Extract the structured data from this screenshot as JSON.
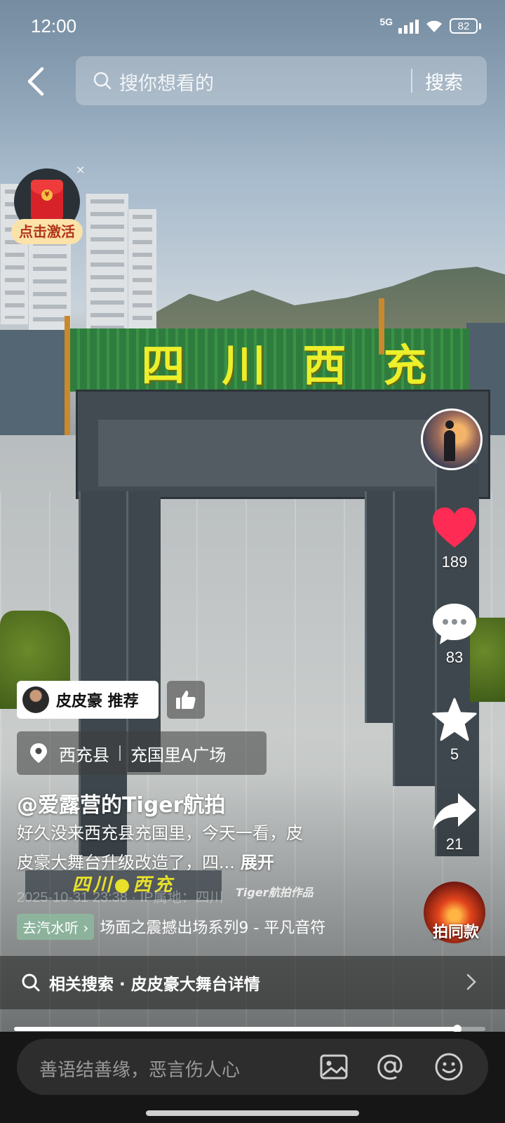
{
  "status_bar": {
    "time": "12:00",
    "network": "5G",
    "battery": "82"
  },
  "search": {
    "placeholder": "搜你想看的",
    "button": "搜索"
  },
  "red_packet": {
    "label": "点击激活",
    "close": "×"
  },
  "video_scene": {
    "sign_chars": [
      "四",
      "川",
      "西",
      "充"
    ]
  },
  "rail": {
    "likes": "189",
    "comments": "83",
    "favorites": "5",
    "shares": "21",
    "remix_label": "拍同款"
  },
  "recommend": {
    "text": "皮皮豪 推荐"
  },
  "location": {
    "county": "西充县",
    "place": "充国里A广场"
  },
  "post": {
    "author": "@爱露营的Tiger航拍",
    "desc_line1": "好久没来西充县充国里，今天一看，皮",
    "desc_line2": "皮豪大舞台升级改造了，四...",
    "expand": "展开",
    "date_ghost": "2025-10-31 23:38 · IP属地：四川"
  },
  "watermark": {
    "banner": "四川●西充",
    "credit": "Tiger航拍作品"
  },
  "music": {
    "button": "去汽水听 ›",
    "title": "场面之震撼出场系列9 - 平凡音符"
  },
  "related": {
    "text": "相关搜索 · 皮皮豪大舞台详情"
  },
  "progress": {
    "fraction": 0.94
  },
  "comment_input": {
    "placeholder": "善语结善缘，恶言伤人心"
  },
  "colors": {
    "like": "#fe2c55",
    "accent_yellow": "#ecef2a",
    "bottom_bar": "#161616"
  }
}
